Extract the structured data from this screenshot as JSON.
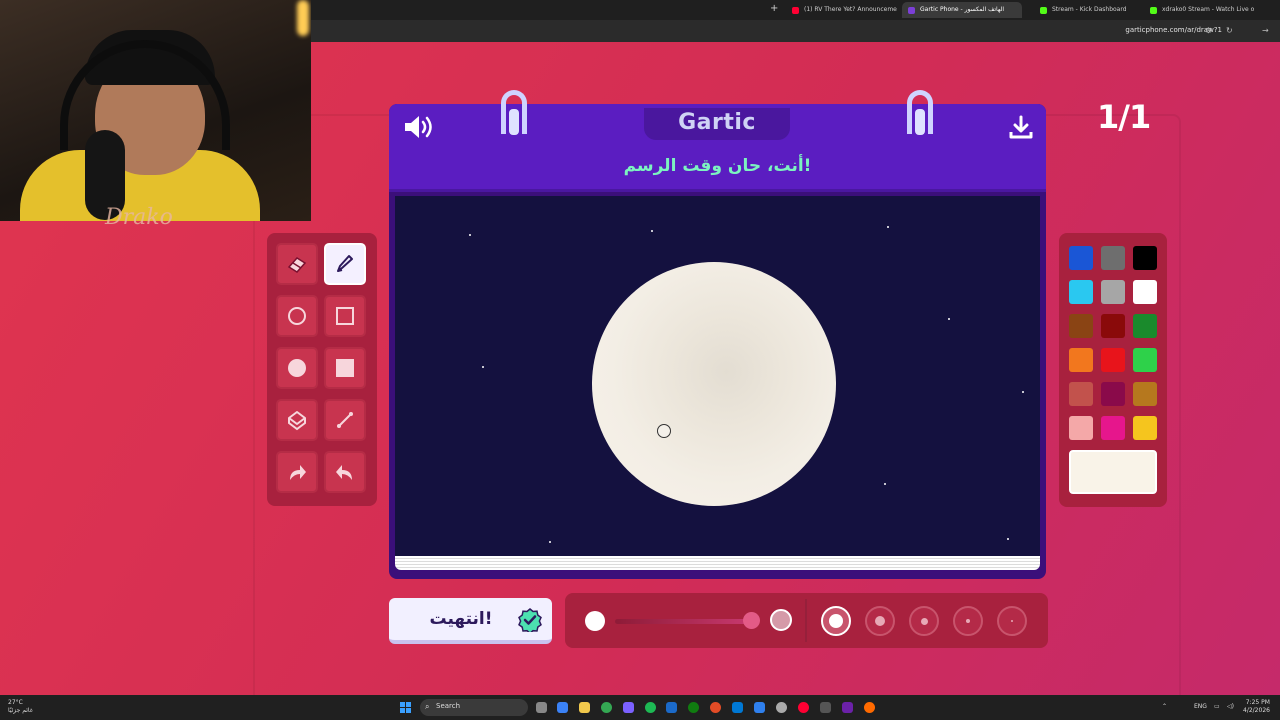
{
  "browser": {
    "tabs": [
      {
        "label": "(1) RV There Yet? Announceme",
        "fav_color": "#ff0033",
        "active": false
      },
      {
        "label": "Gartic Phone - الهاتف المكسور",
        "fav_color": "#7b3fd6",
        "active": true
      },
      {
        "label": "Stream - Kick Dashboard",
        "fav_color": "#53fc18",
        "active": false
      },
      {
        "label": "xdrako0 Stream - Watch Live o",
        "fav_color": "#53fc18",
        "active": false
      }
    ],
    "new_tab": "+",
    "url": "garticphone.com/ar/draw?1"
  },
  "game": {
    "counter": "1/1",
    "logo": "Gartic",
    "prompt": "أنت، حان وقت الرسم!",
    "done_label": "انتهيت!",
    "tools": [
      {
        "name": "eraser-tool",
        "icon": "eraser-icon",
        "active": false
      },
      {
        "name": "pencil-tool",
        "icon": "pencil-icon",
        "active": true
      },
      {
        "name": "ellipse-outline-tool",
        "icon": "circle-outline-icon",
        "active": false
      },
      {
        "name": "rect-outline-tool",
        "icon": "square-outline-icon",
        "active": false
      },
      {
        "name": "ellipse-fill-tool",
        "icon": "circle-filled-icon",
        "active": false
      },
      {
        "name": "rect-fill-tool",
        "icon": "square-filled-icon",
        "active": false
      },
      {
        "name": "fill-bucket-tool",
        "icon": "bucket-icon",
        "active": false
      },
      {
        "name": "line-tool",
        "icon": "line-icon",
        "active": false
      },
      {
        "name": "redo-tool",
        "icon": "redo-icon",
        "active": false
      },
      {
        "name": "undo-tool",
        "icon": "undo-icon",
        "active": false
      }
    ],
    "palette": [
      "#1a56d6",
      "#6e6e6e",
      "#000000",
      "#2ac8f0",
      "#a6a6a6",
      "#ffffff",
      "#8a4414",
      "#8a0a0a",
      "#1a8a2c",
      "#f2771e",
      "#e8141b",
      "#2ed14a",
      "#c2524c",
      "#8a0a4a",
      "#b6781e",
      "#f4a8a8",
      "#e6168c",
      "#f5c51e"
    ],
    "current_color": "#f9f3e8",
    "canvas_bg": "#14113f",
    "brush_sizes": 5,
    "active_size_index": 0
  },
  "taskbar": {
    "weather_temp": "27°C",
    "weather_desc": "غائم جزئيًا",
    "search": "Search",
    "lang": "ENG",
    "time": "7:25 PM",
    "date": "4/2/2026"
  }
}
